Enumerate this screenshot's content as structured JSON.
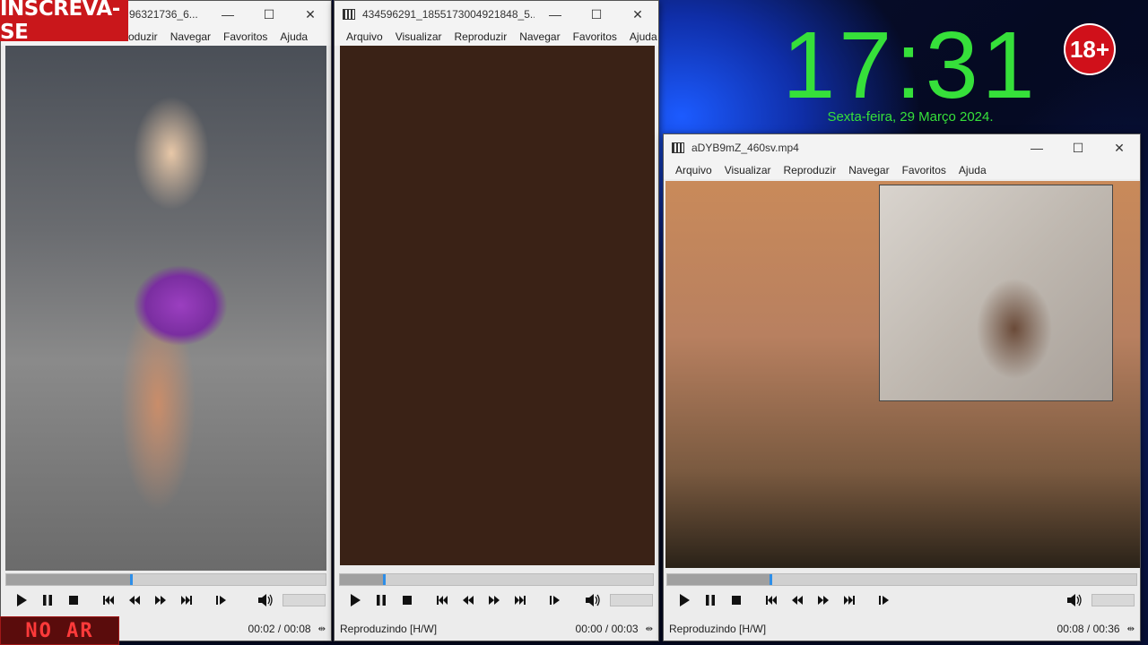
{
  "overlays": {
    "subscribe_label": "INSCREVA-SE",
    "clock_time": "17:31",
    "clock_date": "Sexta-feira, 29 Março 2024.",
    "age_badge": "18+",
    "live_label": "NO AR"
  },
  "menu": [
    "Arquivo",
    "Visualizar",
    "Reproduzir",
    "Navegar",
    "Favoritos",
    "Ajuda"
  ],
  "menu_partial": [
    "roduzir",
    "Navegar",
    "Favoritos",
    "Ajuda"
  ],
  "windows": [
    {
      "title": "96321736_6...",
      "status": "",
      "time": "00:02 / 00:08",
      "progress": 0.39
    },
    {
      "title": "434596291_1855173004921848_5...",
      "status": "Reproduzindo [H/W]",
      "time": "00:00 / 00:03",
      "progress": 0.14
    },
    {
      "title": "aDYB9mZ_460sv.mp4",
      "status": "Reproduzindo [H/W]",
      "time": "00:08 / 00:36",
      "progress": 0.22
    }
  ],
  "colors": {
    "accent_green": "#36e03a",
    "seek_thumb": "#2d8ee8",
    "badge_red": "#d0101a"
  }
}
